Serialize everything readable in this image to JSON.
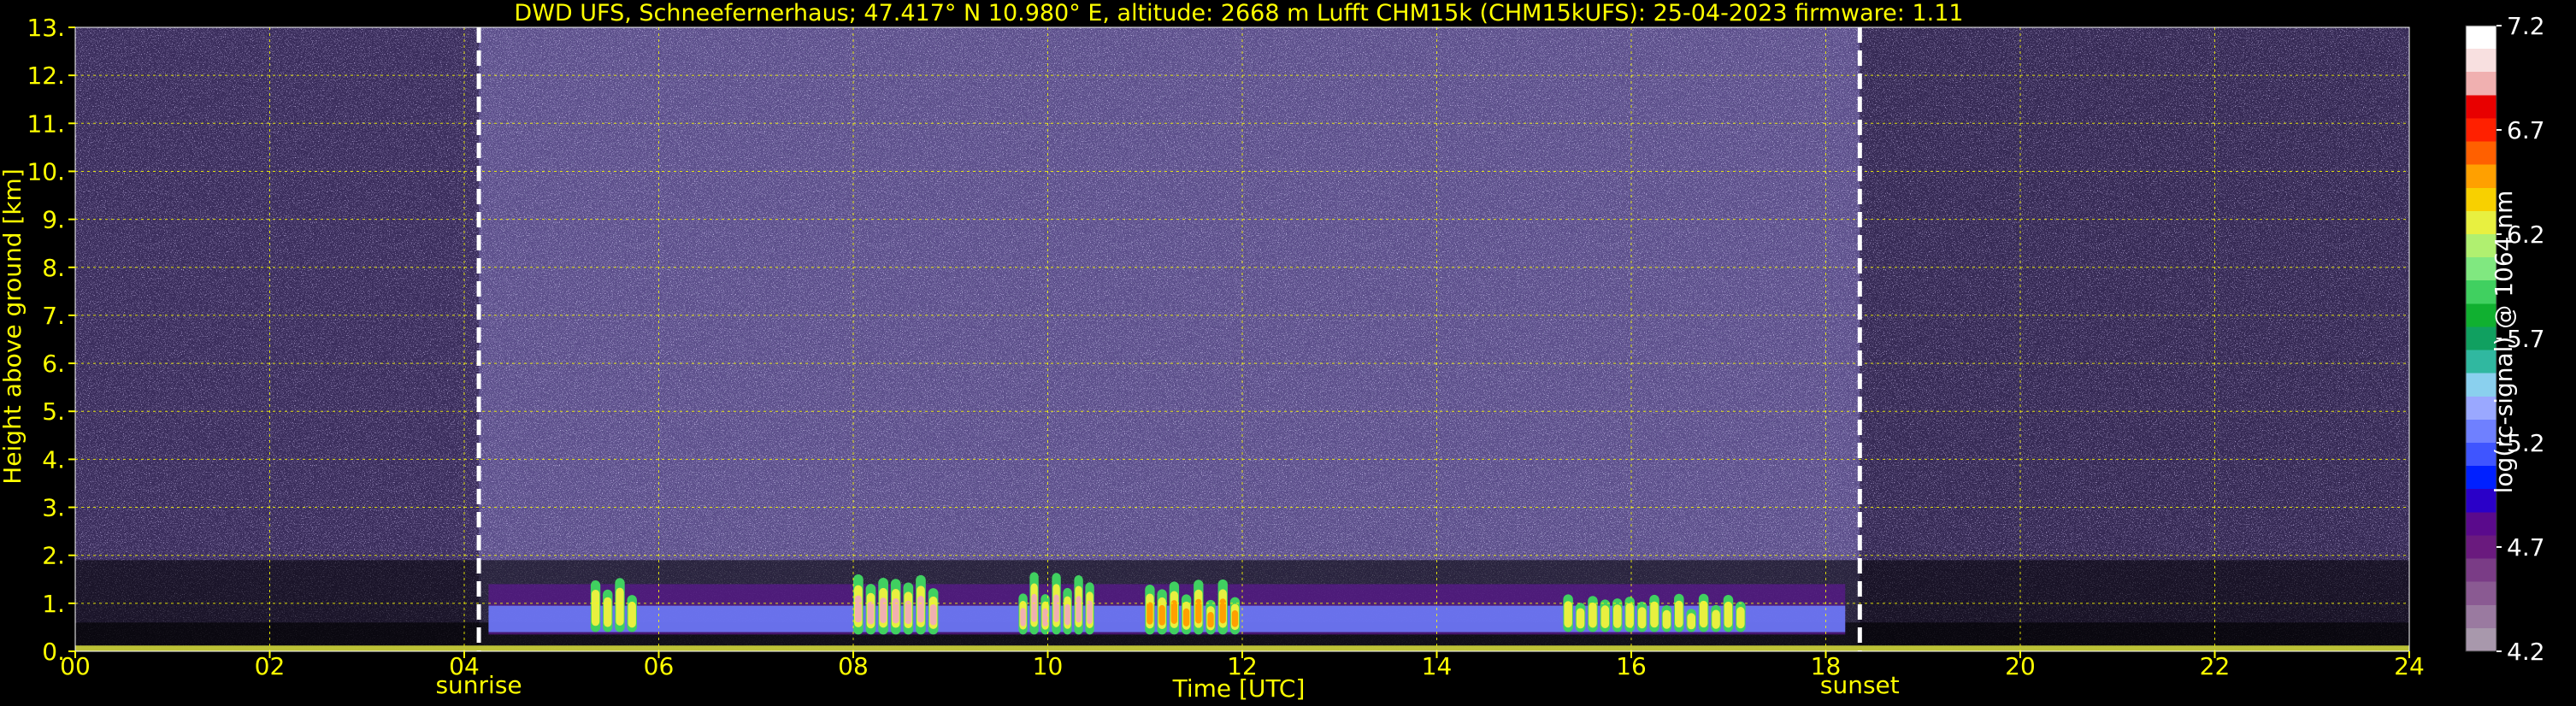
{
  "chart_data": {
    "type": "heatmap",
    "title": "DWD UFS, Schneefernerhaus; 47.417° N 10.980° E, altitude: 2668 m    Lufft CHM15k (CHM15kUFS): 25-04-2023    firmware: 1.11",
    "xlabel": "Time [UTC]",
    "ylabel": "Height above ground [km]",
    "xlim": [
      0,
      24
    ],
    "ylim": [
      0,
      13
    ],
    "x_ticks": [
      {
        "value": 0,
        "label": "00"
      },
      {
        "value": 2,
        "label": "02"
      },
      {
        "value": 4,
        "label": "04"
      },
      {
        "value": 6,
        "label": "06"
      },
      {
        "value": 8,
        "label": "08"
      },
      {
        "value": 10,
        "label": "10"
      },
      {
        "value": 12,
        "label": "12"
      },
      {
        "value": 14,
        "label": "14"
      },
      {
        "value": 16,
        "label": "16"
      },
      {
        "value": 18,
        "label": "18"
      },
      {
        "value": 20,
        "label": "20"
      },
      {
        "value": 22,
        "label": "22"
      },
      {
        "value": 24,
        "label": "24"
      }
    ],
    "y_ticks": [
      {
        "value": 0,
        "label": "0."
      },
      {
        "value": 1,
        "label": "1."
      },
      {
        "value": 2,
        "label": "2."
      },
      {
        "value": 3,
        "label": "3."
      },
      {
        "value": 4,
        "label": "4."
      },
      {
        "value": 5,
        "label": "5."
      },
      {
        "value": 6,
        "label": "6."
      },
      {
        "value": 7,
        "label": "7."
      },
      {
        "value": 8,
        "label": "8."
      },
      {
        "value": 9,
        "label": "9."
      },
      {
        "value": 10,
        "label": "10."
      },
      {
        "value": 11,
        "label": "11."
      },
      {
        "value": 12,
        "label": "12."
      },
      {
        "value": 13,
        "label": "13."
      }
    ],
    "grid": true,
    "annotations": [
      {
        "x": 4.15,
        "label": "sunrise"
      },
      {
        "x": 18.35,
        "label": "sunset"
      }
    ],
    "colorbar": {
      "label": "log(rc-signal) @ 1064 nm",
      "range": [
        4.2,
        7.2
      ],
      "ticks": [
        {
          "value": 4.2,
          "label": "4.2"
        },
        {
          "value": 4.7,
          "label": "4.7"
        },
        {
          "value": 5.2,
          "label": "5.2"
        },
        {
          "value": 5.7,
          "label": "5.7"
        },
        {
          "value": 6.2,
          "label": "6.2"
        },
        {
          "value": 6.7,
          "label": "6.7"
        },
        {
          "value": 7.2,
          "label": "7.2"
        }
      ],
      "colors": [
        "#a898ac",
        "#9a7aa0",
        "#8a5a92",
        "#7a3c86",
        "#6a1a7e",
        "#5a0a8c",
        "#2a00c8",
        "#0020ff",
        "#3f55ff",
        "#6f80ff",
        "#9aa8ff",
        "#8ad0ee",
        "#30b8a0",
        "#10a060",
        "#10b030",
        "#40d060",
        "#80e880",
        "#b0f070",
        "#e8f040",
        "#f8d000",
        "#ffa000",
        "#ff6000",
        "#ff2000",
        "#e80000",
        "#f0b0b0",
        "#f8e0e0",
        "#ffffff"
      ]
    },
    "series": [
      {
        "x": [
          4.25,
          18.2
        ],
        "y": [
          0.35,
          1.4
        ],
        "level": 5.3
      },
      {
        "x": [
          5.3,
          5.8
        ],
        "y": [
          0.4,
          1.55
        ],
        "level": 6.2
      },
      {
        "x": [
          8.0,
          8.9
        ],
        "y": [
          0.35,
          1.65
        ],
        "level": 6.9
      },
      {
        "x": [
          9.7,
          10.5
        ],
        "y": [
          0.35,
          1.65
        ],
        "level": 6.9
      },
      {
        "x": [
          11.0,
          12.0
        ],
        "y": [
          0.35,
          1.5
        ],
        "level": 6.5
      },
      {
        "x": [
          15.3,
          17.2
        ],
        "y": [
          0.4,
          1.2
        ],
        "level": 6.0
      }
    ]
  }
}
